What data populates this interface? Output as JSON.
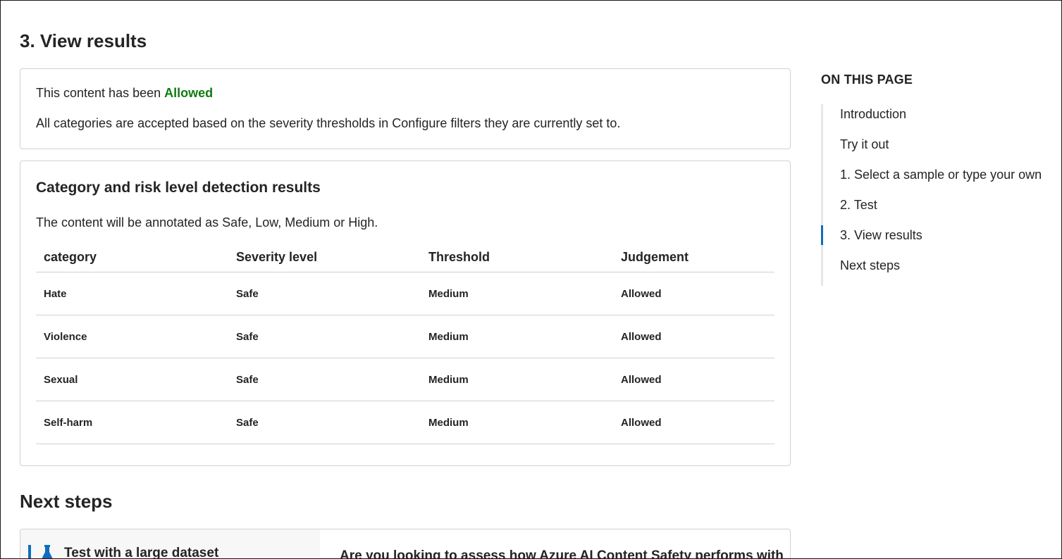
{
  "section_title": "3. View results",
  "status": {
    "prefix": "This content has been ",
    "verdict": "Allowed",
    "description": "All categories are accepted based on the severity thresholds in Configure filters they are currently set to."
  },
  "results": {
    "title": "Category and risk level detection results",
    "subtitle": "The content will be annotated as Safe, Low, Medium or High.",
    "columns": [
      "category",
      "Severity level",
      "Threshold",
      "Judgement"
    ],
    "rows": [
      [
        "Hate",
        "Safe",
        "Medium",
        "Allowed"
      ],
      [
        "Violence",
        "Safe",
        "Medium",
        "Allowed"
      ],
      [
        "Sexual",
        "Safe",
        "Medium",
        "Allowed"
      ],
      [
        "Self-harm",
        "Safe",
        "Medium",
        "Allowed"
      ]
    ]
  },
  "next_steps": {
    "title": "Next steps",
    "card_label": "Test with a large dataset",
    "card_icon": "flask-icon",
    "card_description": "Are you looking to assess how Azure AI Content Safety performs with"
  },
  "toc": {
    "heading": "ON THIS PAGE",
    "items": [
      "Introduction",
      "Try it out",
      "1. Select a sample or type your own",
      "2. Test",
      "3. View results",
      "Next steps"
    ],
    "active_index": 4
  },
  "colors": {
    "allowed": "#107c10",
    "accent": "#0f6cbd",
    "border": "#d1d1d1"
  }
}
